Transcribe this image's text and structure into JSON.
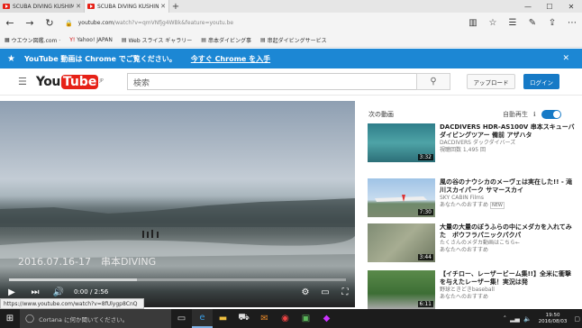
{
  "browser": {
    "tabs": [
      {
        "title": "SCUBA DIVING KUSHIMOT"
      },
      {
        "title": "SCUBA DIVING KUSHIN"
      }
    ],
    "url_domain": "youtube.com",
    "url_path": "/watch?v=qmVNfjg4WBk&feature=youtu.be",
    "favorites": [
      {
        "label": "ウエウン図鑑.com ·"
      },
      {
        "label": "Yahoo! JAPAN"
      },
      {
        "label": "Web スライス ギャラリー"
      },
      {
        "label": "串本ダイビング事"
      },
      {
        "label": "串起ダイビングサービス"
      }
    ]
  },
  "banner": {
    "message": "YouTube 動画は Chrome でご覧ください。",
    "link": "今すぐ Chrome を入手"
  },
  "youtube": {
    "logo_you": "You",
    "logo_tube": "Tube",
    "logo_region": "JP",
    "search_placeholder": "検索",
    "upload_label": "アップロード",
    "login_label": "ログイン",
    "video": {
      "caption": "2016.07.16-17　串本DIVING",
      "time": "0:00 / 2:56",
      "loaded_fraction": 0.38
    },
    "up_next": "次の動画",
    "autoplay": "自動再生",
    "recommendations": [
      {
        "title": "DACDIVERS HDR-AS100V 串本スキューバダイビングツアー 備前 アザハタ",
        "channel": "DACDIVERS ダックダイバーズ",
        "views": "視聴回数 1,495 回",
        "badge": "",
        "duration": "3:32"
      },
      {
        "title": "風の谷のナウシカのメーヴェは実在した!! - 滝川スカイパーク サマースカイ",
        "channel": "SKY CABIN Films",
        "views": "あなたへのおすすめ",
        "badge": "NEW",
        "duration": "7:30"
      },
      {
        "title": "大量の大量のぼうふらの中にメダカを入れてみた　ボウフラパニックパクパ",
        "channel": "たくさんのメダカ動画はこちら←",
        "views": "あなたへのおすすめ",
        "badge": "",
        "duration": "3:44"
      },
      {
        "title": "【イチロー、レーザービーム集!!】全米に衝撃を与えたレーザー集！実況は発",
        "channel": "野球ときどきbaseball",
        "views": "あなたへのおすすめ",
        "badge": "",
        "duration": "6:11"
      }
    ]
  },
  "status_url": "https://www.youtube.com/watch?v=8fUlygp8CnQ",
  "taskbar": {
    "cortana": "Cortana に何か聞いてください。",
    "time": "19:50",
    "date": "2016/08/03"
  }
}
